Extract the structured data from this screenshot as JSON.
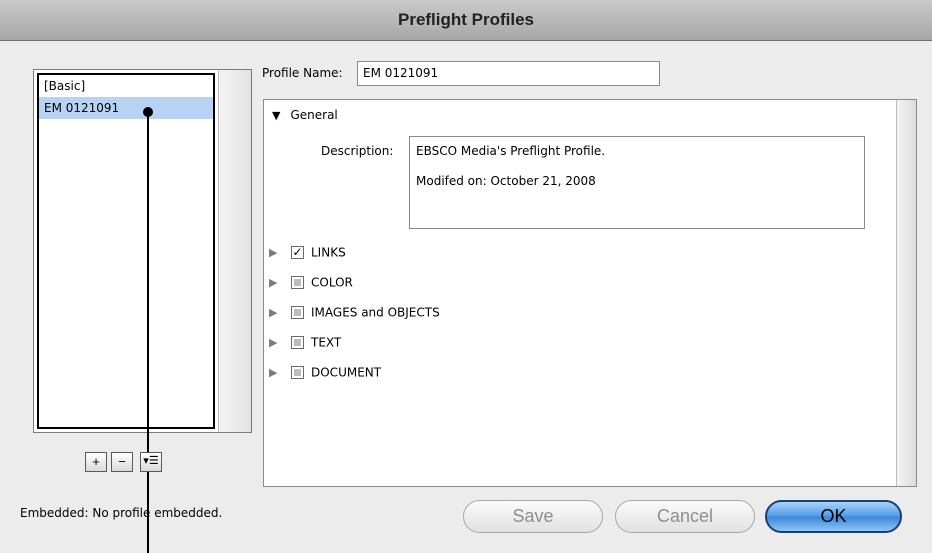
{
  "window": {
    "title": "Preflight Profiles"
  },
  "profiles": {
    "items": [
      {
        "label": "[Basic]"
      },
      {
        "label": "EM 0121091"
      }
    ],
    "buttons": {
      "add": "+",
      "remove": "−",
      "menu": "▾☰"
    }
  },
  "profile_name": {
    "label": "Profile Name:",
    "value": "EM 0121091"
  },
  "general": {
    "label": "General",
    "description_label": "Description:",
    "description_lines": [
      "EBSCO Media's Preflight Profile.",
      "Modifed on: October 21, 2008"
    ]
  },
  "categories": [
    {
      "label": "LINKS",
      "state": "checked"
    },
    {
      "label": "COLOR",
      "state": "mixed"
    },
    {
      "label": "IMAGES and OBJECTS",
      "state": "mixed"
    },
    {
      "label": "TEXT",
      "state": "mixed"
    },
    {
      "label": "DOCUMENT",
      "state": "mixed"
    }
  ],
  "embedded_text": "Embedded: No profile embedded.",
  "footer": {
    "save": "Save",
    "cancel": "Cancel",
    "ok": "OK"
  },
  "colors": {
    "selection": "#b7d2f2",
    "ok_button": "#3a86d9"
  }
}
